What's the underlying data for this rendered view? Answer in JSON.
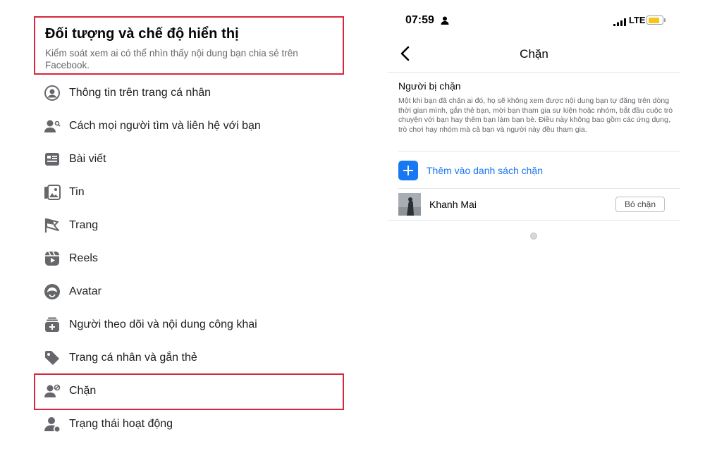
{
  "left": {
    "header": {
      "title": "Đối tượng và chế độ hiển thị",
      "subtitle": "Kiểm soát xem ai có thể nhìn thấy nội dung bạn chia sẻ trên Facebook."
    },
    "menu": [
      {
        "label": "Thông tin trên trang cá nhân",
        "icon": "profile-info-icon"
      },
      {
        "label": "Cách mọi người tìm và liên hệ với bạn",
        "icon": "find-contact-icon"
      },
      {
        "label": "Bài viết",
        "icon": "posts-icon"
      },
      {
        "label": "Tin",
        "icon": "stories-icon"
      },
      {
        "label": "Trang",
        "icon": "pages-flag-icon"
      },
      {
        "label": "Reels",
        "icon": "reels-icon"
      },
      {
        "label": "Avatar",
        "icon": "avatar-face-icon"
      },
      {
        "label": "Người theo dõi và nội dung công khai",
        "icon": "followers-icon"
      },
      {
        "label": "Trang cá nhân và gắn thẻ",
        "icon": "tag-icon"
      },
      {
        "label": "Chặn",
        "icon": "block-user-icon"
      },
      {
        "label": "Trạng thái hoạt động",
        "icon": "active-status-icon"
      }
    ],
    "highlight_color": "#d7263d"
  },
  "phone": {
    "status": {
      "time": "07:59",
      "network": "LTE"
    },
    "nav_title": "Chặn",
    "section_title": "Người bị chặn",
    "section_desc": "Một khi bạn đã chặn ai đó, họ sẽ không xem được nội dung bạn tự đăng trên dòng thời gian mình, gắn thẻ bạn, mời bạn tham gia sự kiện hoặc nhóm, bắt đầu cuộc trò chuyện với bạn hay thêm bạn làm bạn bè. Điều này không bao gồm các ứng dụng, trò chơi hay nhóm mà cả bạn và người này đều tham gia.",
    "add_label": "Thêm vào danh sách chặn",
    "blocked_users": [
      {
        "name": "Khanh Mai",
        "action": "Bỏ chặn"
      }
    ],
    "accent": "#1877f2"
  }
}
